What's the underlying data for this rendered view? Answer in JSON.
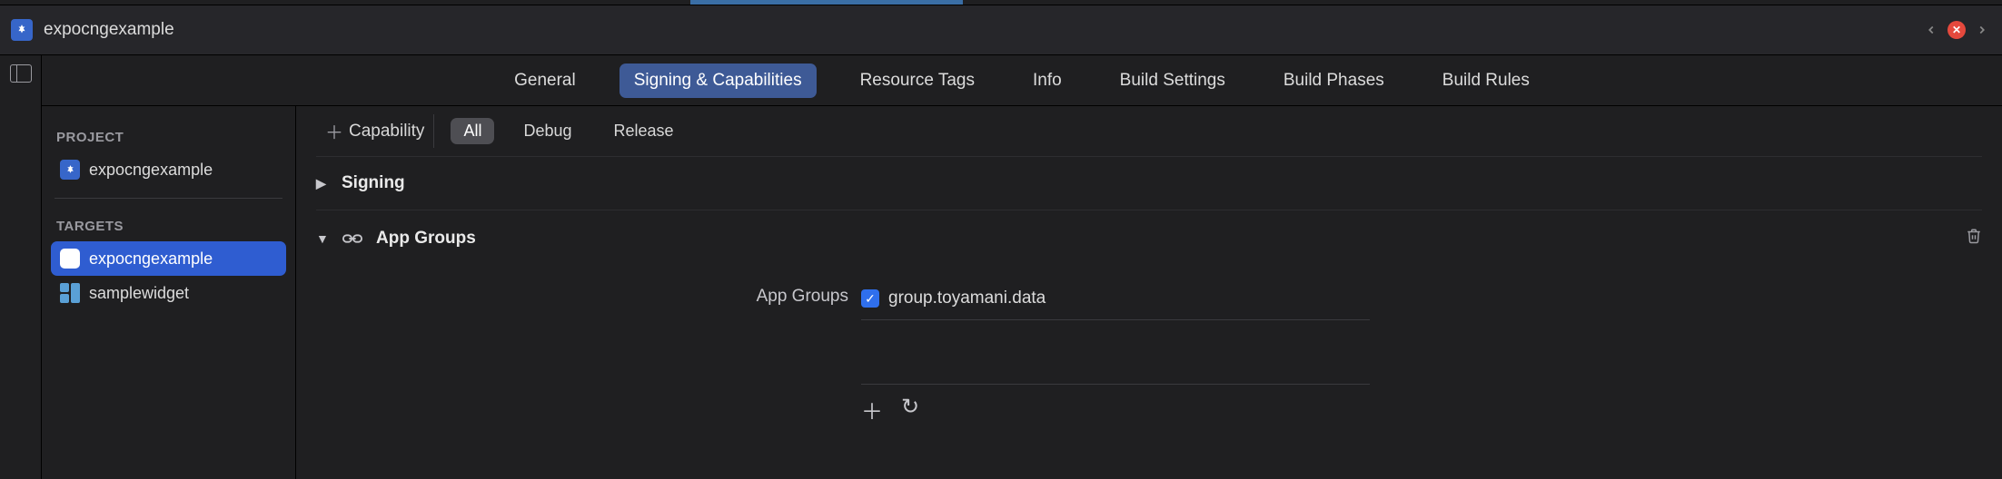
{
  "header": {
    "title": "expocngexample"
  },
  "tabs": [
    {
      "label": "General",
      "active": false
    },
    {
      "label": "Signing & Capabilities",
      "active": true
    },
    {
      "label": "Resource Tags",
      "active": false
    },
    {
      "label": "Info",
      "active": false
    },
    {
      "label": "Build Settings",
      "active": false
    },
    {
      "label": "Build Phases",
      "active": false
    },
    {
      "label": "Build Rules",
      "active": false
    }
  ],
  "sidebar": {
    "projectLabel": "PROJECT",
    "targetsLabel": "TARGETS",
    "project": {
      "name": "expocngexample"
    },
    "targets": [
      {
        "name": "expocngexample",
        "icon": "app",
        "selected": true
      },
      {
        "name": "samplewidget",
        "icon": "widget",
        "selected": false
      }
    ]
  },
  "filters": {
    "addLabel": "Capability",
    "configs": [
      {
        "label": "All",
        "active": true
      },
      {
        "label": "Debug",
        "active": false
      },
      {
        "label": "Release",
        "active": false
      }
    ]
  },
  "sections": {
    "signing": {
      "title": "Signing",
      "expanded": false
    },
    "appGroups": {
      "title": "App Groups",
      "expanded": true,
      "fieldLabel": "App Groups",
      "groups": [
        {
          "name": "group.toyamani.data",
          "checked": true
        }
      ]
    }
  }
}
